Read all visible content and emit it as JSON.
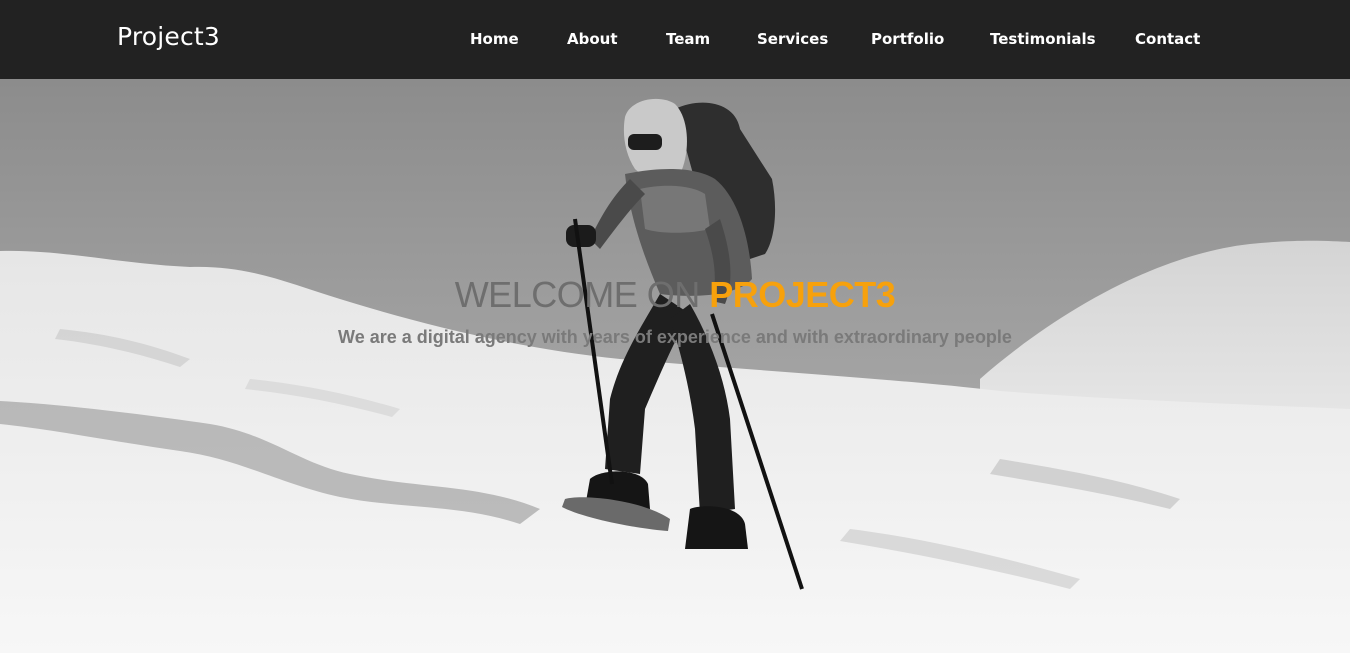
{
  "nav": {
    "brand": "Project3",
    "links": [
      "Home",
      "About",
      "Team",
      "Services",
      "Portfolio",
      "Testimonials",
      "Contact"
    ]
  },
  "hero": {
    "title_prefix": "WELCOME ON ",
    "title_accent": "PROJECT3",
    "subtitle": "We are a digital agency with years of experience and with extraordinary people"
  },
  "colors": {
    "navbar_bg": "#222222",
    "accent": "#f7a10c",
    "title_gray": "#6e6e6e"
  }
}
